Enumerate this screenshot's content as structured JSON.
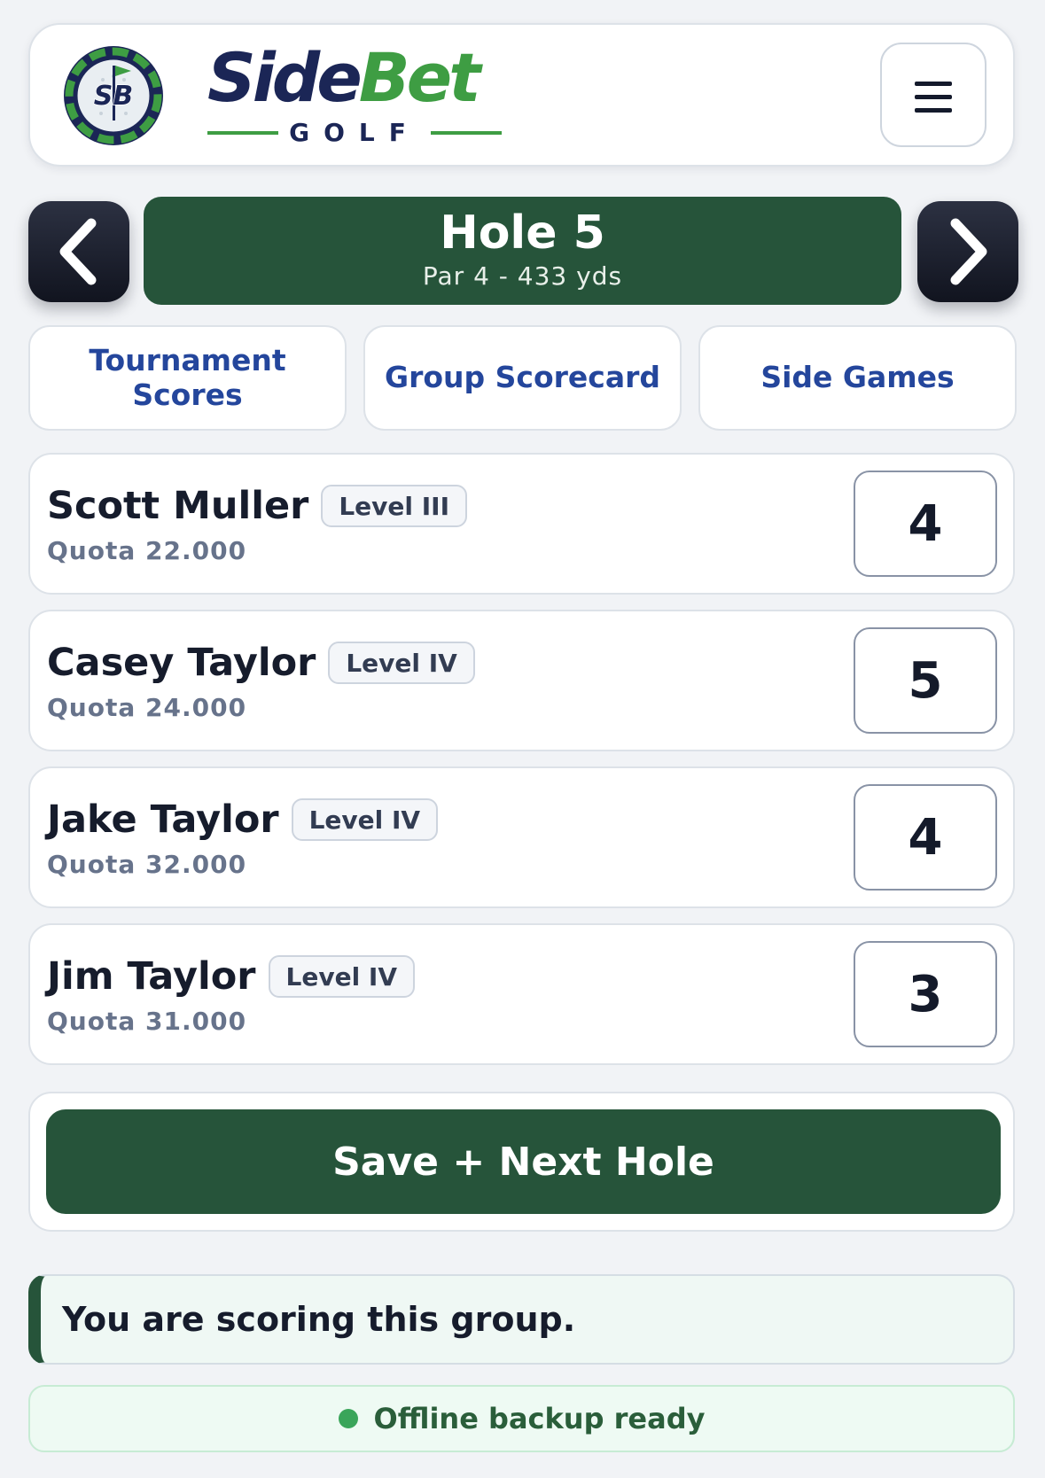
{
  "header": {
    "brand_side": "Side",
    "brand_bet": "Bet",
    "brand_sub": "GOLF",
    "emblem_text": "SB",
    "menu_icon": "hamburger-menu-icon"
  },
  "hole": {
    "title": "Hole 5",
    "subtitle": "Par 4 - 433 yds",
    "prev_icon": "chevron-left-icon",
    "next_icon": "chevron-right-icon"
  },
  "tabs": [
    {
      "label": "Tournament Scores"
    },
    {
      "label": "Group Scorecard"
    },
    {
      "label": "Side Games"
    }
  ],
  "players": [
    {
      "name": "Scott Muller",
      "level": "Level III",
      "quota": "Quota 22.000",
      "score": "4"
    },
    {
      "name": "Casey Taylor",
      "level": "Level IV",
      "quota": "Quota 24.000",
      "score": "5"
    },
    {
      "name": "Jake Taylor",
      "level": "Level IV",
      "quota": "Quota 32.000",
      "score": "4"
    },
    {
      "name": "Jim Taylor",
      "level": "Level IV",
      "quota": "Quota 31.000",
      "score": "3"
    }
  ],
  "save_button": "Save + Next Hole",
  "notice": "You are scoring this group.",
  "offline_status": "Offline backup ready",
  "colors": {
    "brand_navy": "#1b2656",
    "brand_green": "#3e9d43",
    "primary_green": "#26543a",
    "tab_text": "#24469c",
    "status_green": "#3aa55a"
  }
}
